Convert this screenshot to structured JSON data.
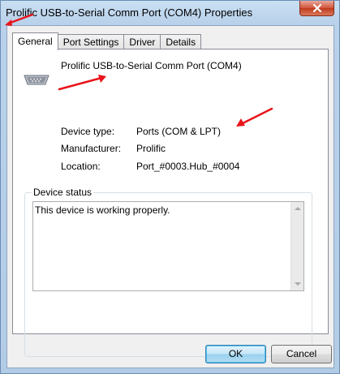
{
  "window": {
    "title": "Prolific USB-to-Serial Comm Port (COM4) Properties",
    "close_icon": "close-icon"
  },
  "tabs": [
    {
      "label": "General",
      "active": true
    },
    {
      "label": "Port Settings",
      "active": false
    },
    {
      "label": "Driver",
      "active": false
    },
    {
      "label": "Details",
      "active": false
    }
  ],
  "general": {
    "device_icon": "serial-port-icon",
    "device_name": "Prolific USB-to-Serial Comm Port (COM4)",
    "properties": [
      {
        "label": "Device type:",
        "value": "Ports (COM & LPT)"
      },
      {
        "label": "Manufacturer:",
        "value": "Prolific"
      },
      {
        "label": "Location:",
        "value": "Port_#0003.Hub_#0004"
      }
    ],
    "device_status": {
      "label": "Device status",
      "text": "This device is working properly."
    }
  },
  "buttons": {
    "ok": "OK",
    "cancel": "Cancel"
  },
  "annotation_color": "#e8141a"
}
